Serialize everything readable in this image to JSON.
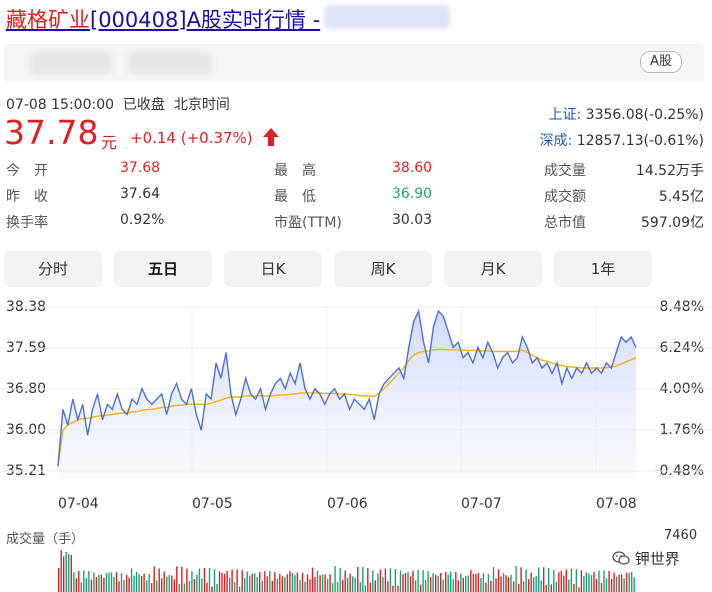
{
  "header": {
    "title_name": "藏格矿业",
    "title_code": "[000408]",
    "title_suffix": "A股实时行情 -",
    "market_badge": "A股"
  },
  "quote": {
    "datetime": "07-08 15:00:00",
    "status": "已收盘",
    "timezone": "北京时间",
    "price": "37.78",
    "unit": "元",
    "change": "+0.14 (+0.37%)"
  },
  "indices": [
    {
      "name": "上证:",
      "value": "3356.08(-0.25%)"
    },
    {
      "name": "深成:",
      "value": "12857.13(-0.61%)"
    }
  ],
  "stats": [
    {
      "label": "今　开",
      "value": "37.68",
      "tone": "up"
    },
    {
      "label": "最　高",
      "value": "38.60",
      "tone": "up"
    },
    {
      "label": "成交量",
      "value": "14.52万手",
      "tone": "plain"
    },
    {
      "label": "昨　收",
      "value": "37.64",
      "tone": "plain"
    },
    {
      "label": "最　低",
      "value": "36.90",
      "tone": "down"
    },
    {
      "label": "成交额",
      "value": "5.45亿",
      "tone": "plain"
    },
    {
      "label": "换手率",
      "value": "0.92%",
      "tone": "plain"
    },
    {
      "label": "市盈(TTM)",
      "value": "30.03",
      "tone": "plain"
    },
    {
      "label": "总市值",
      "value": "597.09亿",
      "tone": "plain"
    }
  ],
  "tabs": [
    {
      "label": "分时",
      "active": false
    },
    {
      "label": "五日",
      "active": true
    },
    {
      "label": "日K",
      "active": false
    },
    {
      "label": "周K",
      "active": false
    },
    {
      "label": "月K",
      "active": false
    },
    {
      "label": "1年",
      "active": false
    }
  ],
  "volume": {
    "label": "成交量（手）",
    "max": "7460"
  },
  "watermark": "钾世界",
  "colors": {
    "up": "#e02020",
    "down": "#1aa278",
    "line": "#4a6fe0",
    "avg": "#f5b400",
    "link": "#1a56c9"
  },
  "chart_data": {
    "type": "line",
    "x_ticks": [
      "07-04",
      "07-05",
      "07-06",
      "07-07",
      "07-08"
    ],
    "y_ticks_left": [
      "38.38",
      "37.59",
      "36.80",
      "36.00",
      "35.21"
    ],
    "y_ticks_right": [
      "8.48%",
      "6.24%",
      "4.00%",
      "1.76%",
      "-0.48%"
    ],
    "ylim": [
      35.21,
      38.38
    ],
    "series": [
      {
        "name": "price",
        "values": [
          35.3,
          36.4,
          36.1,
          36.6,
          36.2,
          36.5,
          35.9,
          36.4,
          36.7,
          36.2,
          36.5,
          36.4,
          36.7,
          36.4,
          36.3,
          36.6,
          36.5,
          36.8,
          36.6,
          36.5,
          36.6,
          36.7,
          36.3,
          36.7,
          36.9,
          36.6,
          36.5,
          36.8,
          36.3,
          36.0,
          36.7,
          36.6,
          37.3,
          37.0,
          37.5,
          36.7,
          36.3,
          36.6,
          37.0,
          36.7,
          36.6,
          36.8,
          36.4,
          36.7,
          36.9,
          37.0,
          36.8,
          37.1,
          36.9,
          37.3,
          36.8,
          36.6,
          36.8,
          36.7,
          36.5,
          36.7,
          36.8,
          36.6,
          36.7,
          36.4,
          36.6,
          36.5,
          36.4,
          36.6,
          36.2,
          36.7,
          36.9,
          37.0,
          37.1,
          37.2,
          37.0,
          37.6,
          38.1,
          38.3,
          37.7,
          37.3,
          38.0,
          38.3,
          38.2,
          37.9,
          37.6,
          37.7,
          37.4,
          37.5,
          37.3,
          37.6,
          37.4,
          37.7,
          37.5,
          37.2,
          37.4,
          37.5,
          37.3,
          37.4,
          37.8,
          37.6,
          37.3,
          37.4,
          37.2,
          37.3,
          37.1,
          37.3,
          36.9,
          37.2,
          37.0,
          37.2,
          37.1,
          37.3,
          37.1,
          37.2,
          37.1,
          37.3,
          37.2,
          37.5,
          37.8,
          37.7,
          37.8,
          37.6
        ],
        "color": "#4a6fe0"
      },
      {
        "name": "avg",
        "values": [
          35.3,
          36.0,
          36.1,
          36.15,
          36.2,
          36.22,
          36.23,
          36.25,
          36.27,
          36.28,
          36.29,
          36.3,
          36.32,
          36.33,
          36.34,
          36.35,
          36.36,
          36.38,
          36.4,
          36.4,
          36.42,
          36.44,
          36.44,
          36.46,
          36.48,
          36.48,
          36.5,
          36.5,
          36.5,
          36.5,
          36.5,
          36.52,
          36.55,
          36.58,
          36.62,
          36.64,
          36.64,
          36.64,
          36.66,
          36.66,
          36.66,
          36.67,
          36.66,
          36.66,
          36.67,
          36.68,
          36.68,
          36.69,
          36.7,
          36.72,
          36.72,
          36.72,
          36.72,
          36.72,
          36.71,
          36.71,
          36.71,
          36.7,
          36.7,
          36.69,
          36.68,
          36.67,
          36.66,
          36.66,
          36.65,
          36.72,
          36.8,
          36.9,
          37.0,
          37.1,
          37.2,
          37.35,
          37.45,
          37.5,
          37.52,
          37.53,
          37.55,
          37.56,
          37.56,
          37.55,
          37.55,
          37.55,
          37.55,
          37.54,
          37.54,
          37.54,
          37.53,
          37.53,
          37.52,
          37.52,
          37.52,
          37.52,
          37.52,
          37.52,
          37.55,
          37.5,
          37.45,
          37.4,
          37.35,
          37.33,
          37.3,
          37.27,
          37.25,
          37.23,
          37.22,
          37.21,
          37.2,
          37.2,
          37.2,
          37.2,
          37.2,
          37.21,
          37.22,
          37.24,
          37.28,
          37.32,
          37.36,
          37.4
        ],
        "color": "#f5b400"
      }
    ]
  }
}
